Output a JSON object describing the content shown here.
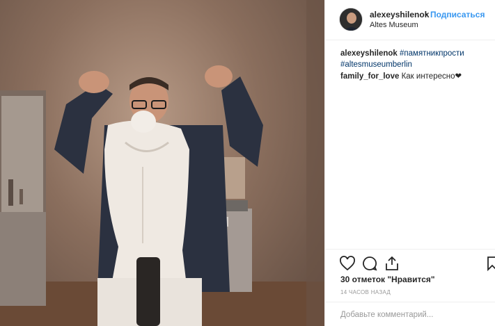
{
  "post": {
    "username": "alexeyshilenok",
    "separator": "•",
    "follow_label": "Подписаться",
    "location": "Altes Museum"
  },
  "caption": {
    "username": "alexeyshilenok",
    "tag1": "#памятникпрости",
    "tag2": "#altesmuseumberlin"
  },
  "comments": [
    {
      "username": "family_for_love",
      "text": "Как интересно❤"
    }
  ],
  "stats": {
    "likes": "30 отметок \"Нравится\"",
    "time": "14 ЧАСОВ НАЗАД"
  },
  "add_comment": {
    "placeholder": "Добавьте комментарий..."
  },
  "icons": {
    "like": "heart-icon",
    "comment": "comment-icon",
    "share": "share-icon",
    "save": "bookmark-icon"
  },
  "colors": {
    "link": "#3897f0",
    "hashtag": "#003569",
    "muted": "#999999",
    "border": "#efefef"
  }
}
